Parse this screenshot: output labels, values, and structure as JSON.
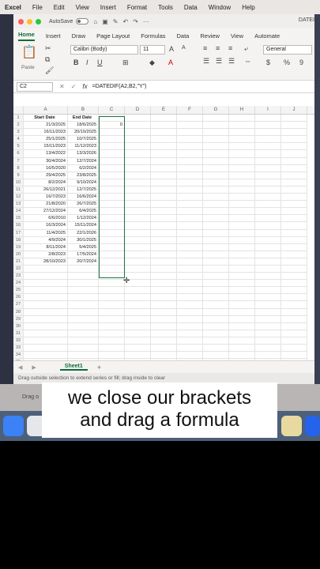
{
  "menubar": {
    "items": [
      "Excel",
      "File",
      "Edit",
      "View",
      "Insert",
      "Format",
      "Tools",
      "Data",
      "Window",
      "Help"
    ]
  },
  "titlebar": {
    "autosave": "AutoSave",
    "doc_title": "DATEI"
  },
  "ribbon_tabs": [
    "Home",
    "Insert",
    "Draw",
    "Page Layout",
    "Formulas",
    "Data",
    "Review",
    "View",
    "Automate"
  ],
  "ribbon": {
    "font": "Calibri (Body)",
    "size": "11",
    "number_format": "General",
    "paste": "Paste"
  },
  "formula_bar": {
    "cell": "C2",
    "formula": "=DATEDIF(A2,B2,\"Y\")"
  },
  "columns": [
    "A",
    "B",
    "C",
    "D",
    "E",
    "F",
    "G",
    "H",
    "I",
    "J"
  ],
  "headers": {
    "a": "Start Date",
    "b": "End Date"
  },
  "rows": [
    {
      "a": "21/3/2025",
      "b": "18/6/2025",
      "c": "0"
    },
    {
      "a": "16/11/2023",
      "b": "20/10/2025",
      "c": ""
    },
    {
      "a": "25/1/2025",
      "b": "10/7/2025",
      "c": ""
    },
    {
      "a": "15/11/2023",
      "b": "11/12/2023",
      "c": ""
    },
    {
      "a": "13/4/2022",
      "b": "13/3/2026",
      "c": ""
    },
    {
      "a": "30/4/2024",
      "b": "12/7/2024",
      "c": ""
    },
    {
      "a": "16/5/2020",
      "b": "6/2/2024",
      "c": ""
    },
    {
      "a": "29/4/2025",
      "b": "23/8/2025",
      "c": ""
    },
    {
      "a": "8/2/2024",
      "b": "9/10/2024",
      "c": ""
    },
    {
      "a": "26/12/2021",
      "b": "12/7/2025",
      "c": ""
    },
    {
      "a": "16/7/2023",
      "b": "16/6/2024",
      "c": ""
    },
    {
      "a": "21/8/2020",
      "b": "26/7/2025",
      "c": ""
    },
    {
      "a": "27/12/2024",
      "b": "6/4/2025",
      "c": ""
    },
    {
      "a": "6/6/2010",
      "b": "1/12/2024",
      "c": ""
    },
    {
      "a": "16/3/2024",
      "b": "15/11/2024",
      "c": ""
    },
    {
      "a": "11/4/2025",
      "b": "22/1/2026",
      "c": ""
    },
    {
      "a": "4/9/2024",
      "b": "30/1/2025",
      "c": ""
    },
    {
      "a": "8/11/2024",
      "b": "5/4/2025",
      "c": ""
    },
    {
      "a": "2/8/2023",
      "b": "17/5/2024",
      "c": ""
    },
    {
      "a": "28/10/2023",
      "b": "20/7/2024",
      "c": ""
    }
  ],
  "sheet_tab": "Sheet1",
  "status": "Drag outside selection to extend series or fill; drag inside to clear",
  "status_ghost": "Drag o",
  "caption": {
    "line1": "we close our brackets",
    "line2": "and drag a formula"
  },
  "colors": {
    "accent": "#0e6b3a",
    "dock": "#4d607a"
  }
}
